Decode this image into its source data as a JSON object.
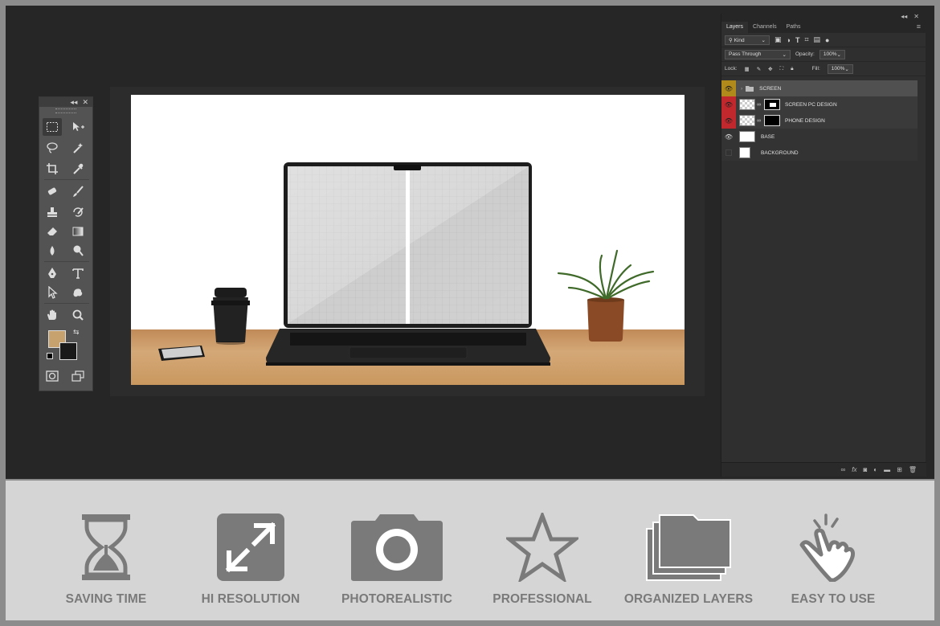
{
  "layers_panel": {
    "tabs": [
      "Layers",
      "Channels",
      "Paths"
    ],
    "filter_label": "Kind",
    "blend_mode": "Pass Through",
    "opacity_label": "Opacity:",
    "opacity_value": "100%",
    "lock_label": "Lock:",
    "fill_label": "Fill:",
    "fill_value": "100%",
    "layers": [
      {
        "name": "SCREEN",
        "type": "group",
        "eye_color": "#b08a1a"
      },
      {
        "name": "SCREEN PC DESIGN",
        "type": "smart",
        "eye_color": "#c0282d"
      },
      {
        "name": "PHONE DESIGN",
        "type": "smart",
        "eye_color": "#c0282d"
      },
      {
        "name": "BASE",
        "type": "pixel",
        "eye_color": ""
      },
      {
        "name": "BACKGROUND",
        "type": "pixel",
        "eye_color": ""
      }
    ]
  },
  "toolbox": {
    "foreground_color": "#c8a26e",
    "background_color": "#1a1a1a"
  },
  "features": [
    {
      "icon": "hourglass-icon",
      "label": "SAVING TIME"
    },
    {
      "icon": "expand-arrows-icon",
      "label": "HI RESOLUTION"
    },
    {
      "icon": "camera-icon",
      "label": "PHOTOREALISTIC"
    },
    {
      "icon": "star-icon",
      "label": "PROFESSIONAL"
    },
    {
      "icon": "folder-stack-icon",
      "label": "ORGANIZED LAYERS"
    },
    {
      "icon": "tap-hand-icon",
      "label": "EASY TO USE"
    }
  ]
}
